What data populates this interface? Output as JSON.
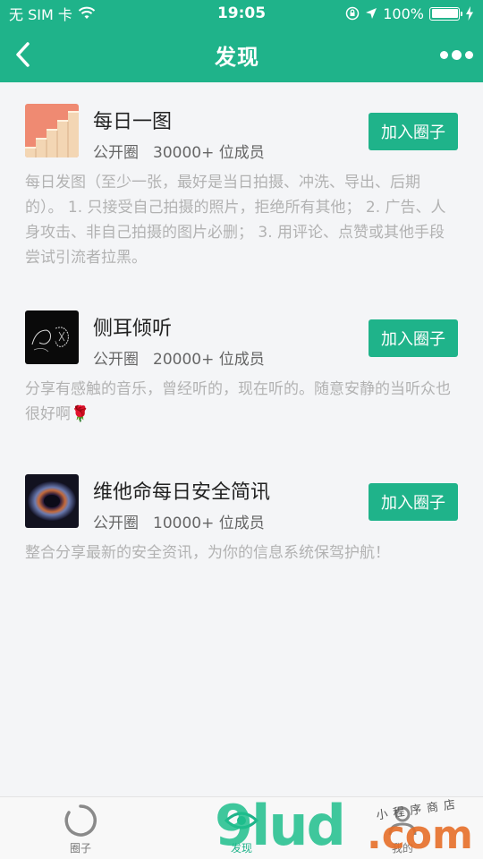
{
  "status": {
    "carrier": "无 SIM 卡",
    "time": "19:05",
    "battery": "100%"
  },
  "nav": {
    "title": "发现"
  },
  "groups": [
    {
      "name": "每日一图",
      "type": "公开圈",
      "members": "30000+ 位成员",
      "button": "加入圈子",
      "description": "每日发图（至少一张，最好是当日拍摄、冲洗、导出、后期的）。 1. 只接受自己拍摄的照片，拒绝所有其他； 2. 广告、人身攻击、非自己拍摄的图片必删； 3. 用评论、点赞或其他手段尝试引流者拉黑。"
    },
    {
      "name": "侧耳倾听",
      "type": "公开圈",
      "members": "20000+ 位成员",
      "button": "加入圈子",
      "description": "分享有感触的音乐，曾经听的，现在听的。随意安静的当听众也很好啊🌹"
    },
    {
      "name": "维他命每日安全简讯",
      "type": "公开圈",
      "members": "10000+ 位成员",
      "button": "加入圈子",
      "description": "整合分享最新的安全资讯，为你的信息系统保驾护航！"
    }
  ],
  "tabs": [
    {
      "label": "圈子",
      "icon": "loading-circle-icon"
    },
    {
      "label": "发现",
      "icon": "eye-icon"
    },
    {
      "label": "我的",
      "icon": "person-icon"
    }
  ],
  "watermark": {
    "main": "9lud",
    "dot": ".com",
    "small": "小程序商店"
  },
  "colors": {
    "accent": "#1fb38a",
    "background": "#f4f5f7"
  }
}
